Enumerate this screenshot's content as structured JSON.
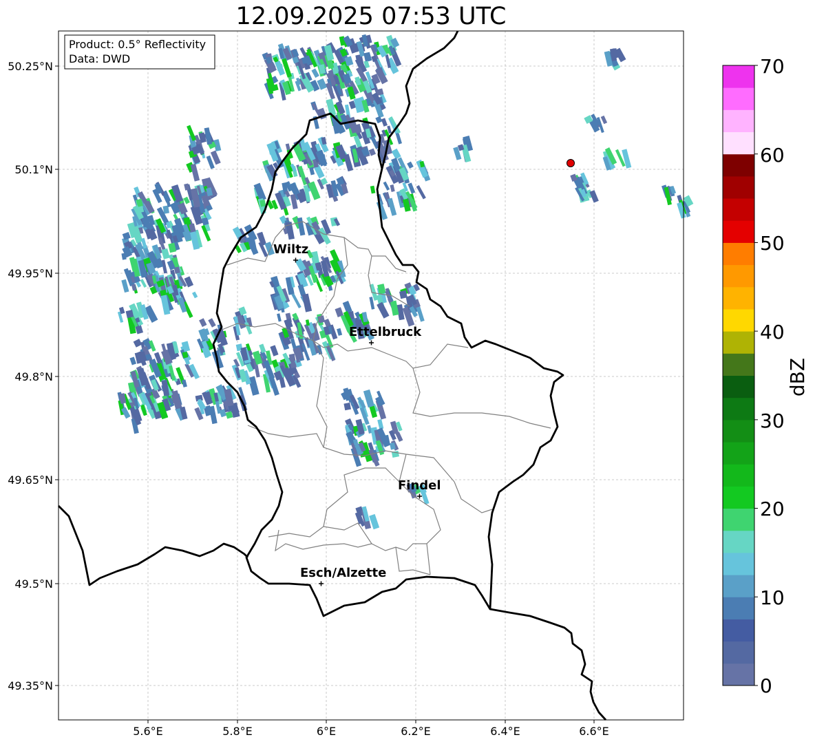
{
  "title": "12.09.2025 07:53 UTC",
  "info_box": {
    "product": "Product: 0.5° Reflectivity",
    "data": "Data: DWD"
  },
  "axes": {
    "lon_ticks": [
      "5.6°E",
      "5.8°E",
      "6°E",
      "6.2°E",
      "6.4°E",
      "6.6°E"
    ],
    "lat_ticks": [
      "50.25°N",
      "50.1°N",
      "49.95°N",
      "49.8°N",
      "49.65°N",
      "49.5°N",
      "49.35°N"
    ]
  },
  "cities": [
    {
      "name": "Wiltz"
    },
    {
      "name": "Ettelbruck"
    },
    {
      "name": "Findel"
    },
    {
      "name": "Esch/Alzette"
    }
  ],
  "colorbar": {
    "label": "dBZ",
    "ticks": [
      "0",
      "10",
      "20",
      "30",
      "40",
      "50",
      "60",
      "70"
    ],
    "colors": [
      "#6673a6",
      "#5469a2",
      "#445ca2",
      "#4b7db3",
      "#5aa0c8",
      "#66c4dc",
      "#66d6c4",
      "#3fd470",
      "#13c921",
      "#13b81b",
      "#13a318",
      "#138e15",
      "#0d7a14",
      "#0a5e10",
      "#44771a",
      "#afb304",
      "#ffd800",
      "#ffb300",
      "#ff9900",
      "#ff7d00",
      "#e40000",
      "#c40000",
      "#a00000",
      "#7e0000",
      "#ffe0ff",
      "#ffb3ff",
      "#ff6cff",
      "#ee33ee"
    ]
  },
  "colors": {
    "border": "#000000",
    "canton_boundary": "#808080",
    "station_marker": "#e00000",
    "grid": "#bbbbbb"
  }
}
